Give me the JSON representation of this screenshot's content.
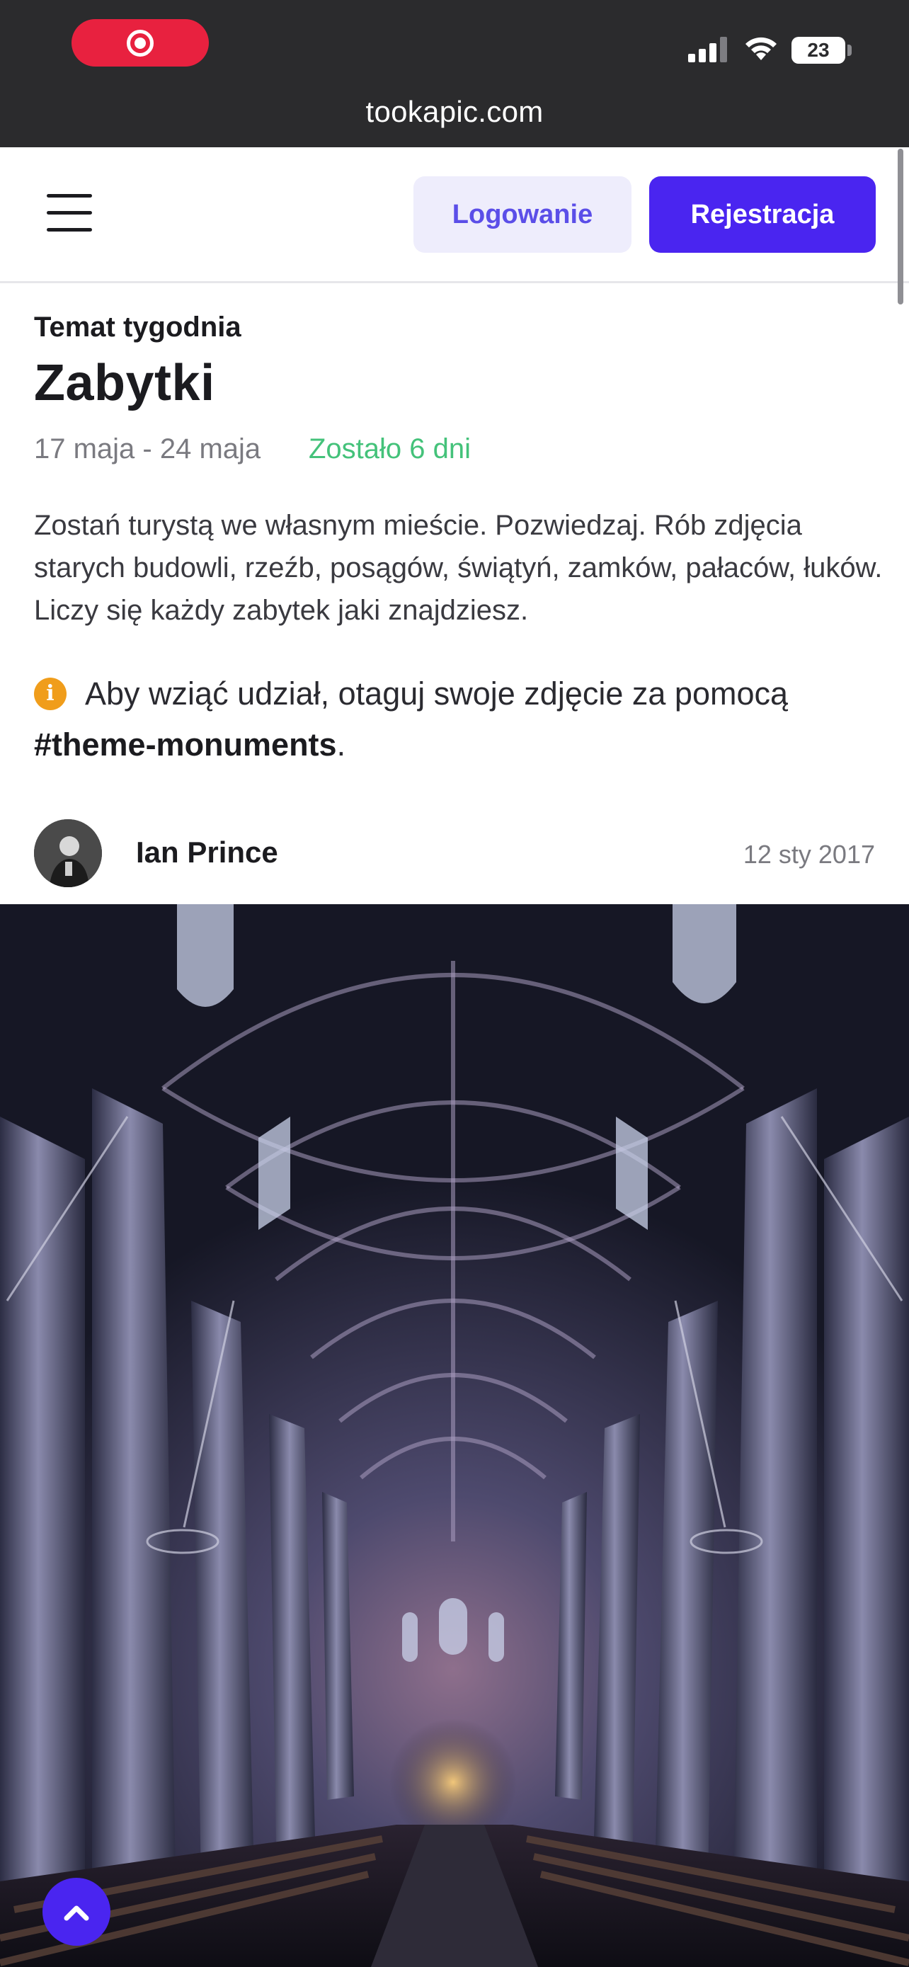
{
  "status_bar": {
    "battery_level": "23",
    "recording_icon": "record-icon",
    "signal_icon": "cellular-signal-icon",
    "wifi_icon": "wifi-icon"
  },
  "browser": {
    "url": "tookapic.com"
  },
  "header": {
    "menu_icon": "hamburger-menu-icon",
    "login_label": "Logowanie",
    "register_label": "Rejestracja"
  },
  "theme": {
    "label": "Temat tygodnia",
    "title": "Zabytki",
    "date_range": "17 maja - 24 maja",
    "days_left": "Zostało 6 dni",
    "description": "Zostań turystą we własnym mieście. Pozwiedzaj. Rób zdjęcia starych budowli, rzeźb, posągów, świątyń, zamków, pałaców, łuków. Liczy się każdy zabytek jaki znajdziesz.",
    "info_text": "Aby wziąć udział, otaguj swoje zdjęcie za pomocą",
    "hashtag": "#theme-monuments",
    "info_suffix": "."
  },
  "post": {
    "author": "Ian Prince",
    "date": "12 sty 2017"
  },
  "colors": {
    "accent": "#4a25f0",
    "accent_soft": "#eeedfc",
    "success": "#44c27a",
    "warning": "#f09d1b",
    "status_bar_bg": "#2b2b2d",
    "record_red": "#e8213f"
  },
  "back_to_top_icon": "chevron-up-icon"
}
